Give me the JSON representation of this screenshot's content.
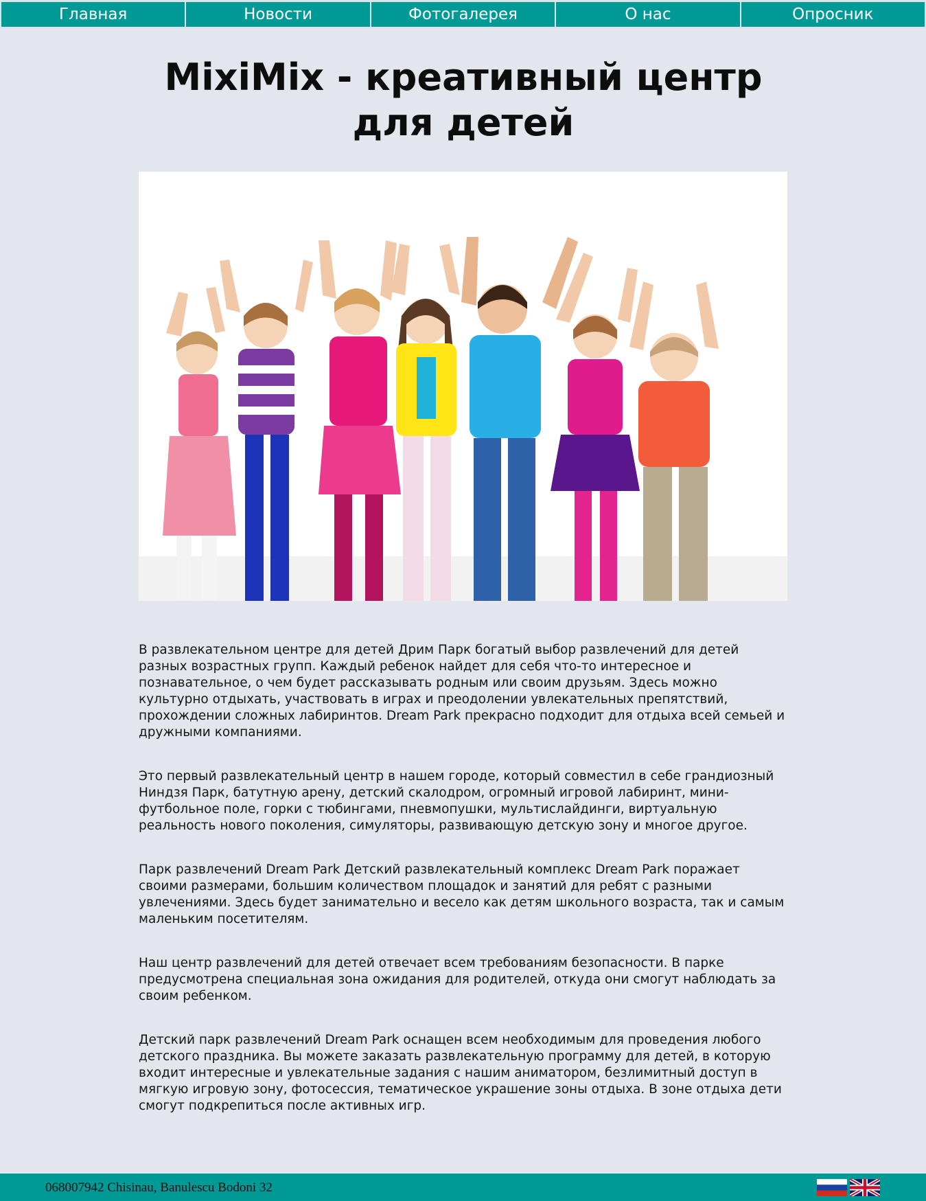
{
  "nav": {
    "items": [
      "Главная",
      "Новости",
      "Фотогалерея",
      "О нас",
      "Опросник"
    ]
  },
  "title": "MixiMix - креативный центр для детей",
  "hero": {
    "icon": "photo-children-raising-hands"
  },
  "paragraphs": [
    "В развлекательном центре для детей Дрим Парк богатый выбор развлечений для детей разных возрастных групп. Каждый ребенок найдет для себя что-то интересное и познавательное, о чем будет рассказывать родным или своим друзьям. Здесь можно культурно отдыхать, участвовать в играх и преодолении увлекательных препятствий, прохождении сложных лабиринтов. Dream Park прекрасно подходит для отдыха всей семьей и дружными компаниями.",
    "Это первый развлекательный центр в нашем городе, который совместил в себе грандиозный Ниндзя Парк, батутную арену, детский скалодром, огромный игровой лабиринт, мини-футбольное поле, горки с тюбингами, пневмопушки, мультислайдинги, виртуальную реальность нового поколения, симуляторы, развивающую детскую зону и многое другое.",
    "Парк развлечений Dream Park Детский развлекательный комплекс Dream Park поражает своими размерами, большим количеством площадок и занятий для ребят с разными увлечениями. Здесь будет занимательно и весело как детям школьного возраста, так и самым маленьким посетителям.",
    "Наш центр развлечений для детей отвечает всем требованиям безопасности. В парке предусмотрена специальная зона ожидания для родителей, откуда они смогут наблюдать за своим ребенком.",
    "Детский парк развлечений Dream Park оснащен всем необходимым для проведения любого детского праздника. Вы можете заказать развлекательную программу для детей, в которую входит интересные и увлекательные задания с нашим аниматором, безлимитный доступ в мягкую игровую зону, фотосессия, тематическое украшение зоны отдыха. В зоне отдыха дети смогут подкрепиться после активных игр."
  ],
  "footer": {
    "address": "068007942 Chisinau, Banulescu Bodoni 32",
    "flags": [
      "russia-flag-icon",
      "uk-flag-icon"
    ]
  },
  "colors": {
    "accent": "#009a96",
    "background": "#e3e6ed"
  }
}
